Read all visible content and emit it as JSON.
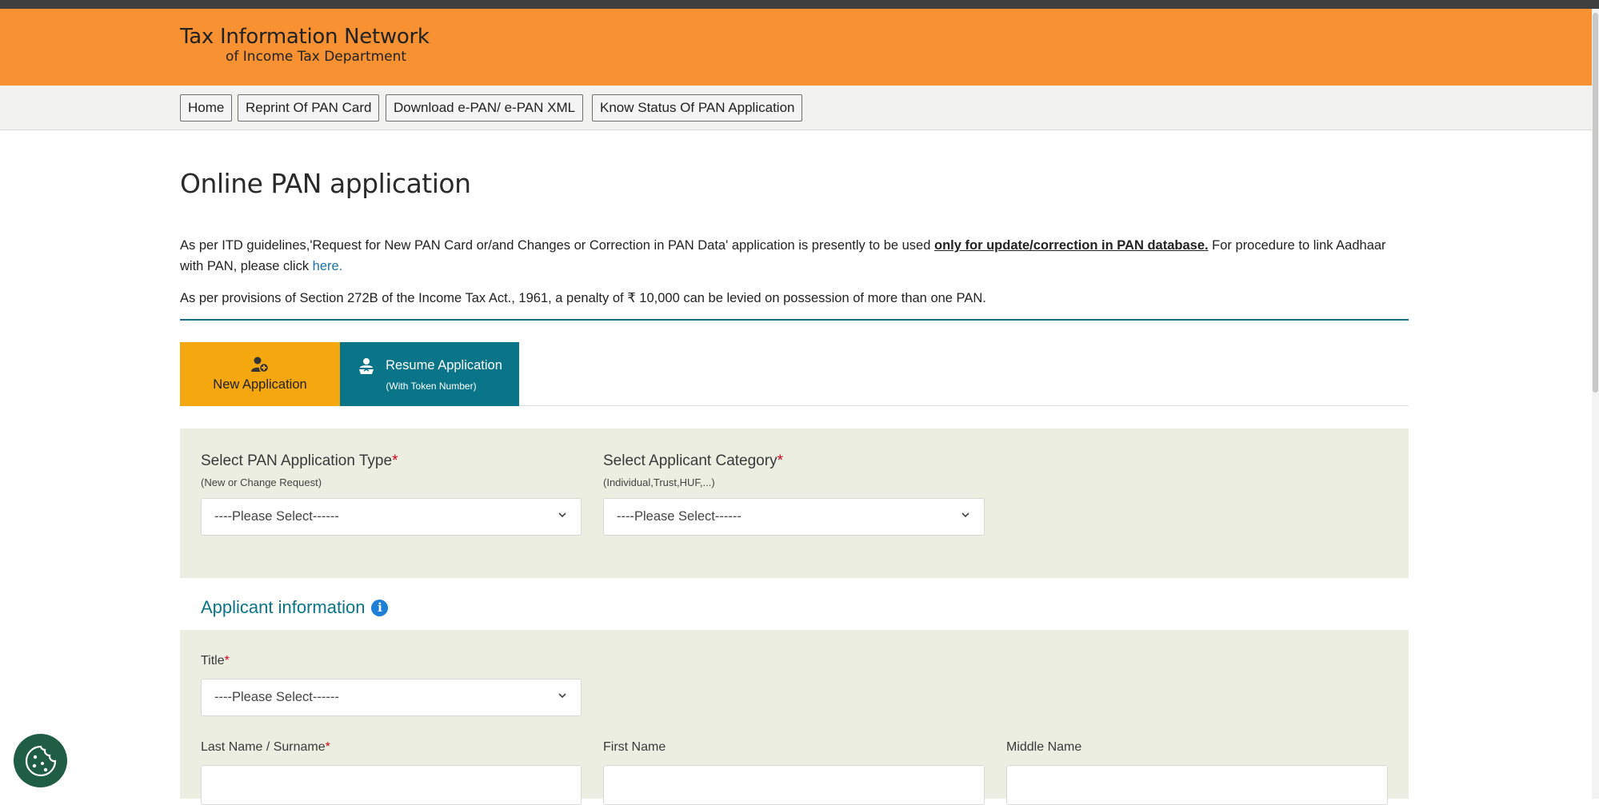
{
  "header": {
    "logo_line1": "Tax Information Network",
    "logo_line2": "of Income Tax Department"
  },
  "nav": {
    "items": [
      {
        "label": "Home"
      },
      {
        "label": "Reprint Of PAN Card"
      },
      {
        "label": "Download e-PAN/ e-PAN XML"
      },
      {
        "label": "Know Status Of PAN Application"
      }
    ]
  },
  "page": {
    "title": "Online PAN application",
    "para1_a": "As per ITD guidelines,'Request for New PAN Card or/and Changes or Correction in PAN Data' application is presently to be used ",
    "para1_bold": "only for update/correction in PAN database.",
    "para1_b": " For procedure to link Aadhaar with PAN, please click ",
    "para1_link": "here.",
    "para2": "As per provisions of Section 272B of the Income Tax Act., 1961, a penalty of ₹ 10,000 can be levied on possession of more than one PAN."
  },
  "tabs": {
    "new_label": "New Application",
    "resume_label": "Resume Application",
    "resume_sub": "(With Token Number)"
  },
  "form": {
    "app_type_label": "Select PAN Application Type",
    "app_type_hint": "(New or Change Request)",
    "app_type_value": "----Please Select------",
    "category_label": "Select Applicant Category",
    "category_hint": "(Individual,Trust,HUF,...)",
    "category_value": "----Please Select------",
    "required_mark": "*"
  },
  "applicant": {
    "section_title": "Applicant information",
    "title_label": "Title",
    "title_value": "----Please Select------",
    "last_name_label": "Last Name / Surname",
    "first_name_label": "First Name",
    "middle_name_label": "Middle Name"
  },
  "colors": {
    "header_orange": "#f79131",
    "tab_new": "#f5a70f",
    "tab_resume": "#0a7489",
    "panel": "#ebeee0"
  }
}
